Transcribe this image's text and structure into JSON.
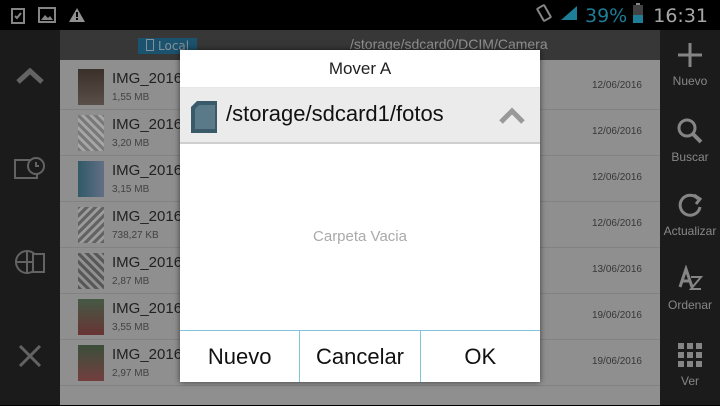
{
  "status": {
    "battery_pct": "39%",
    "time": "16:31"
  },
  "file_list": {
    "tab_local": "Local",
    "path": "/storage/sdcard0/DCIM/Camera",
    "rows": [
      {
        "name": "IMG_2016",
        "size": "1,55 MB",
        "date": "12/06/2016"
      },
      {
        "name": "IMG_2016",
        "size": "3,20 MB",
        "date": "12/06/2016"
      },
      {
        "name": "IMG_2016",
        "size": "3,15 MB",
        "date": "12/06/2016"
      },
      {
        "name": "IMG_2016",
        "size": "738,27 KB",
        "date": "12/06/2016"
      },
      {
        "name": "IMG_2016",
        "size": "2,87 MB",
        "date": "13/06/2016"
      },
      {
        "name": "IMG_2016",
        "size": "3,55 MB",
        "date": "19/06/2016"
      },
      {
        "name": "IMG_2016",
        "size": "2,97 MB",
        "date": "19/06/2016"
      }
    ]
  },
  "right_bar": {
    "nuevo": "Nuevo",
    "buscar": "Buscar",
    "actualizar": "Actualizar",
    "ordenar": "Ordenar",
    "ver": "Ver"
  },
  "dialog": {
    "title": "Mover A",
    "path": "/storage/sdcard1/fotos",
    "empty_text": "Carpeta Vacia",
    "buttons": {
      "nuevo": "Nuevo",
      "cancelar": "Cancelar",
      "ok": "OK"
    }
  },
  "colors": {
    "accent": "#2ec0e8",
    "divider": "#7fc4d8"
  }
}
